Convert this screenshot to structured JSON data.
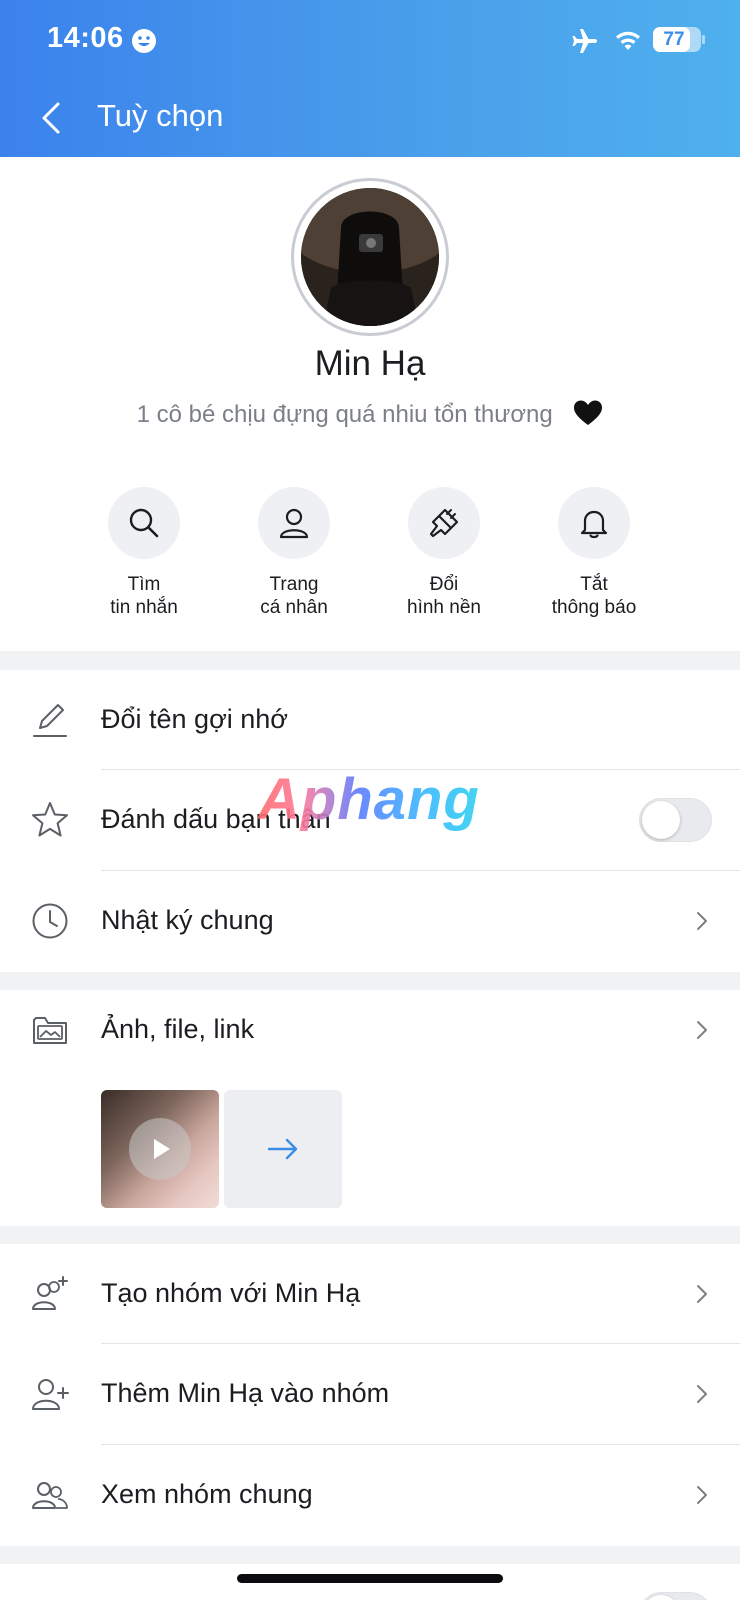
{
  "status_bar": {
    "time": "14:06",
    "battery_level": "77",
    "battery_fraction": 0.77,
    "airplane_mode": true,
    "icons": [
      "smiley-icon",
      "airplane-icon",
      "wifi-icon",
      "battery-icon"
    ]
  },
  "header": {
    "title": "Tuỳ chọn",
    "back_icon": "chevron-left-icon"
  },
  "profile": {
    "name": "Min Hạ",
    "status": "1 cô bé chịu đựng quá nhiu tổn thương",
    "status_emoji": "black-heart-icon"
  },
  "actions": [
    {
      "line1": "Tìm",
      "line2": "tin nhắn",
      "icon": "search-icon"
    },
    {
      "line1": "Trang",
      "line2": "cá nhân",
      "icon": "person-icon"
    },
    {
      "line1": "Đổi",
      "line2": "hình nền",
      "icon": "paint-brush-icon"
    },
    {
      "line1": "Tắt",
      "line2": "thông báo",
      "icon": "bell-icon"
    }
  ],
  "settings_1": {
    "rename": {
      "label": "Đổi tên gợi nhớ",
      "icon": "pencil-icon"
    },
    "best_friend": {
      "label": "Đánh dấu bạn thân",
      "icon": "star-icon",
      "toggle_on": false
    },
    "diary": {
      "label": "Nhật ký chung",
      "icon": "clock-icon"
    }
  },
  "media": {
    "label": "Ảnh, file, link",
    "icon": "photo-folder-icon",
    "thumbnail_icon": "play-icon",
    "more_icon": "arrow-right-icon"
  },
  "groups": {
    "create": {
      "label": "Tạo nhóm với Min Hạ",
      "icon": "group-add-icon"
    },
    "add": {
      "label": "Thêm Min Hạ vào nhóm",
      "icon": "person-add-icon"
    },
    "common": {
      "label": "Xem nhóm chung",
      "icon": "group-icon"
    }
  },
  "watermark": "Aphang",
  "colors": {
    "header_start": "#3b82ec",
    "header_end": "#4fb0ee",
    "accent": "#3b8de8",
    "toggle_off": "#e9eaee"
  }
}
